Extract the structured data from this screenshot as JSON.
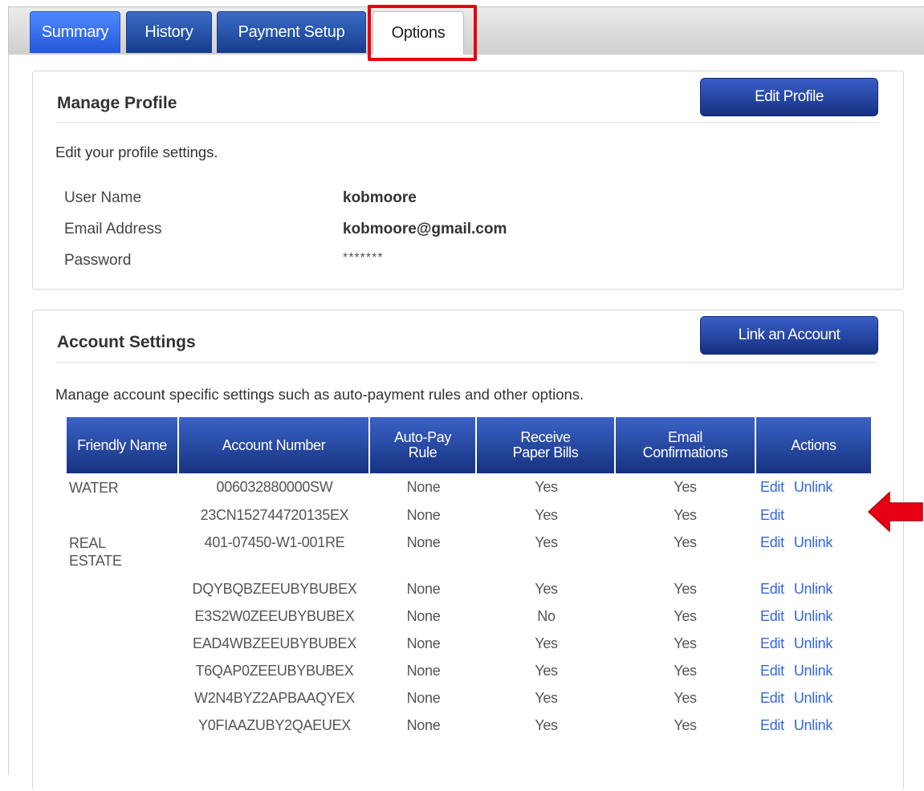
{
  "tabs": [
    {
      "label": "Summary"
    },
    {
      "label": "History"
    },
    {
      "label": "Payment Setup"
    },
    {
      "label": "Options"
    }
  ],
  "profile": {
    "title": "Manage Profile",
    "edit_button": "Edit Profile",
    "description": "Edit your profile settings.",
    "fields": [
      {
        "label": "User Name",
        "value": "kobmoore"
      },
      {
        "label": "Email Address",
        "value": "kobmoore@gmail.com"
      },
      {
        "label": "Password",
        "value": "*******"
      }
    ]
  },
  "accounts": {
    "title": "Account Settings",
    "link_button": "Link an Account",
    "description": "Manage account specific settings such as auto-payment rules and other options.",
    "columns": [
      "Friendly Name",
      "Account Number",
      "Auto-Pay Rule",
      "Receive Paper Bills",
      "Email Confirmations",
      "Actions"
    ],
    "action_edit": "Edit",
    "action_unlink": "Unlink",
    "rows": [
      {
        "name": "WATER",
        "number": "006032880000SW",
        "autopay": "None",
        "paper": "Yes",
        "email": "Yes",
        "edit": "Edit",
        "unlink": "Unlink"
      },
      {
        "name": "",
        "number": "23CN152744720135EX",
        "autopay": "None",
        "paper": "Yes",
        "email": "Yes",
        "edit": "Edit",
        "unlink": ""
      },
      {
        "name": "REAL ESTATE",
        "number": "401-07450-W1-001RE",
        "autopay": "None",
        "paper": "Yes",
        "email": "Yes",
        "edit": "Edit",
        "unlink": "Unlink"
      },
      {
        "name": "",
        "number": "DQYBQBZEEUBYBUBEX",
        "autopay": "None",
        "paper": "Yes",
        "email": "Yes",
        "edit": "Edit",
        "unlink": "Unlink"
      },
      {
        "name": "",
        "number": "E3S2W0ZEEUBYBUBEX",
        "autopay": "None",
        "paper": "No",
        "email": "Yes",
        "edit": "Edit",
        "unlink": "Unlink"
      },
      {
        "name": "",
        "number": "EAD4WBZEEUBYBUBEX",
        "autopay": "None",
        "paper": "Yes",
        "email": "Yes",
        "edit": "Edit",
        "unlink": "Unlink"
      },
      {
        "name": "",
        "number": "T6QAP0ZEEUBYBUBEX",
        "autopay": "None",
        "paper": "Yes",
        "email": "Yes",
        "edit": "Edit",
        "unlink": "Unlink"
      },
      {
        "name": "",
        "number": "W2N4BYZ2APBAAQYEX",
        "autopay": "None",
        "paper": "Yes",
        "email": "Yes",
        "edit": "Edit",
        "unlink": "Unlink"
      },
      {
        "name": "",
        "number": "Y0FIAAZUBY2QAEUEX",
        "autopay": "None",
        "paper": "Yes",
        "email": "Yes",
        "edit": "Edit",
        "unlink": "Unlink"
      }
    ]
  },
  "colors": {
    "accent_blue": "#1a3a8f",
    "highlight_red": "#e60012",
    "link_blue": "#3366dd"
  }
}
